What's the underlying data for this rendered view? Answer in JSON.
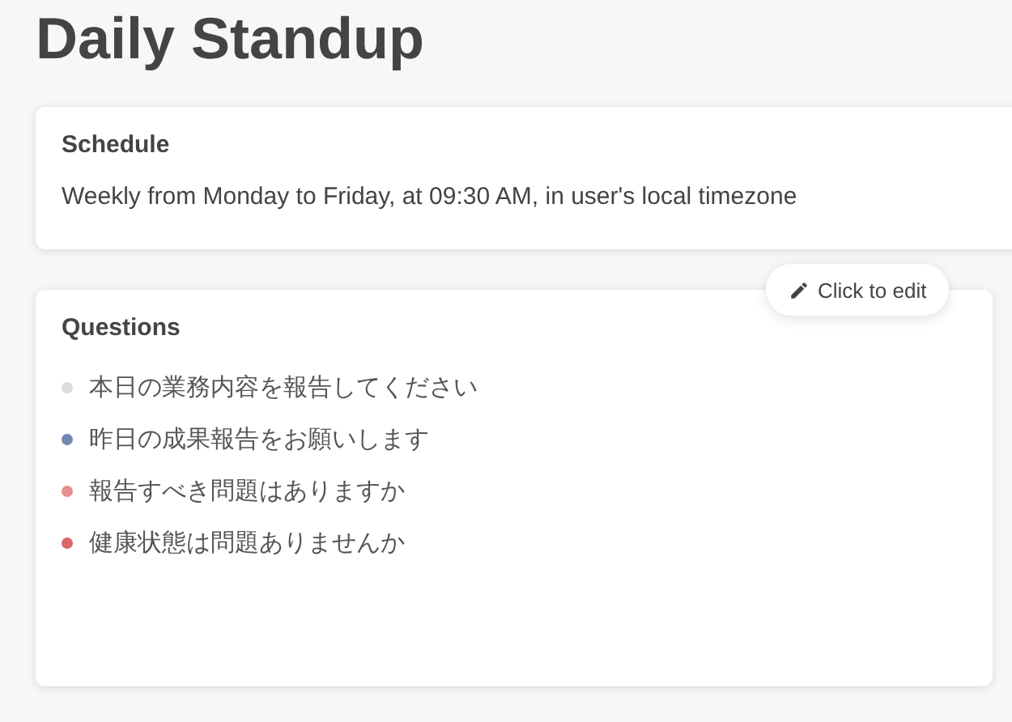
{
  "title": "Daily Standup",
  "schedule": {
    "heading": "Schedule",
    "text": "Weekly from Monday to Friday, at 09:30 AM, in user's local timezone"
  },
  "edit_button": {
    "label": "Click to edit"
  },
  "questions": {
    "heading": "Questions",
    "items": [
      {
        "text": "本日の業務内容を報告してください",
        "color": "#dddddd"
      },
      {
        "text": "昨日の成果報告をお願いします",
        "color": "#7189b1"
      },
      {
        "text": "報告すべき問題はありますか",
        "color": "#e88e8e"
      },
      {
        "text": "健康状態は問題ありませんか",
        "color": "#de6565"
      }
    ]
  }
}
